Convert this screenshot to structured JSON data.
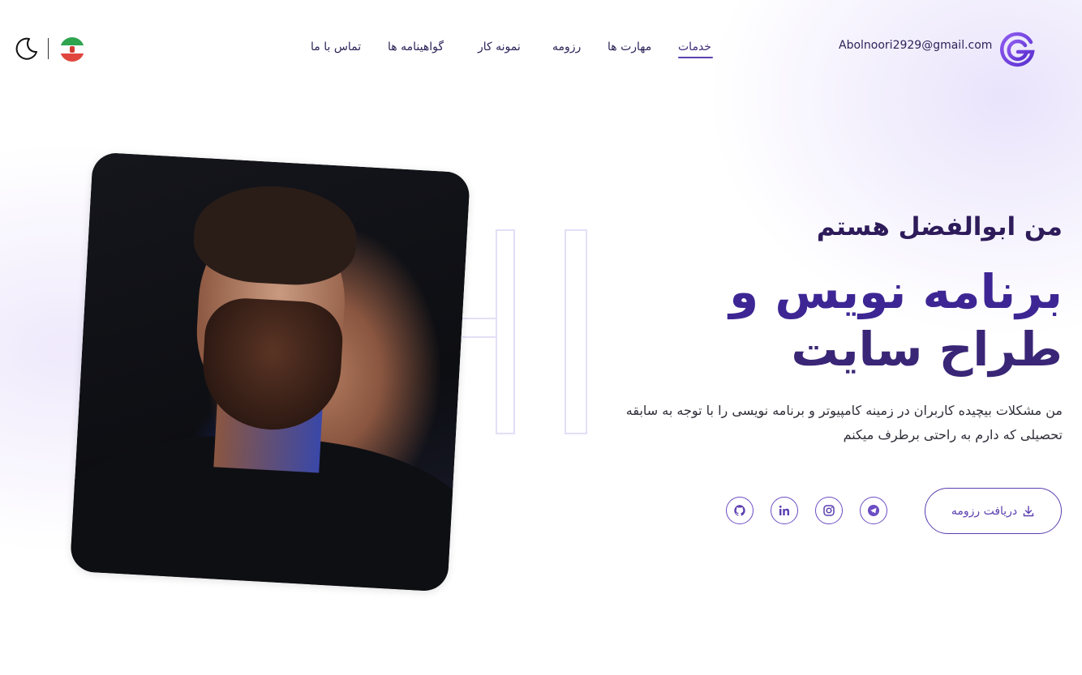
{
  "header": {
    "email": "Abolnoori2929@gmail.com",
    "nav": [
      {
        "label": "خدمات",
        "active": true
      },
      {
        "label": "مهارت ها",
        "active": false
      },
      {
        "label": "رزومه",
        "active": false
      },
      {
        "label": "نمونه کار",
        "active": false
      },
      {
        "label": "گواهینامه ها",
        "active": false
      },
      {
        "label": "تماس با ما",
        "active": false
      }
    ],
    "language_flag": "iran-flag-icon",
    "theme_toggle": "moon-icon"
  },
  "hero": {
    "intro": "من ابوالفضل هستم",
    "role_line1": "برنامه نویس و",
    "role_line2": "طراح سایت",
    "background_text": "HI",
    "description": "من مشکلات بیچیده کاربران در زمینه کامپیوتر و برنامه نویسی را با توجه به سابقه تحصیلی که دارم به راحتی برطرف میکنم",
    "cv_button": "دریافت رزومه",
    "social": [
      "telegram-icon",
      "instagram-icon",
      "linkedin-icon",
      "github-icon"
    ]
  },
  "colors": {
    "accent": "#5b3fb0",
    "heading_dark": "#2d1b5a",
    "text": "#2f2f3a"
  }
}
